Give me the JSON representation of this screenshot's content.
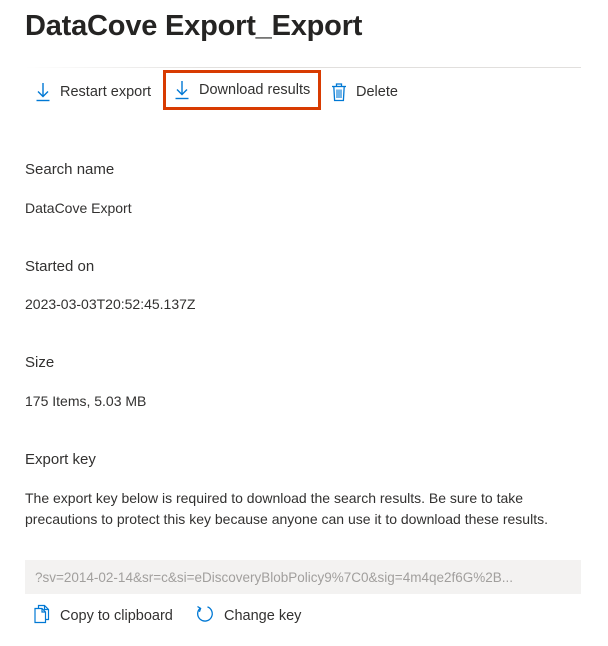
{
  "header": {
    "title": "DataCove Export_Export"
  },
  "toolbar": {
    "restart_label": "Restart export",
    "download_label": "Download results",
    "delete_label": "Delete"
  },
  "details": {
    "search_name": {
      "label": "Search name",
      "value": "DataCove Export"
    },
    "started_on": {
      "label": "Started on",
      "value": "2023-03-03T20:52:45.137Z"
    },
    "size": {
      "label": "Size",
      "value": "175 Items, 5.03 MB"
    }
  },
  "export_key": {
    "label": "Export key",
    "description": "The export key below is required to download the search results. Be sure to take precautions to protect this key because anyone can use it to download these results.",
    "value": "?sv=2014-02-14&sr=c&si=eDiscoveryBlobPolicy9%7C0&sig=4m4qe2f6G%2B...",
    "copy_label": "Copy to clipboard",
    "change_label": "Change key"
  },
  "colors": {
    "accent": "#0078d4",
    "highlight_border": "#d83b01",
    "text": "#323130"
  }
}
